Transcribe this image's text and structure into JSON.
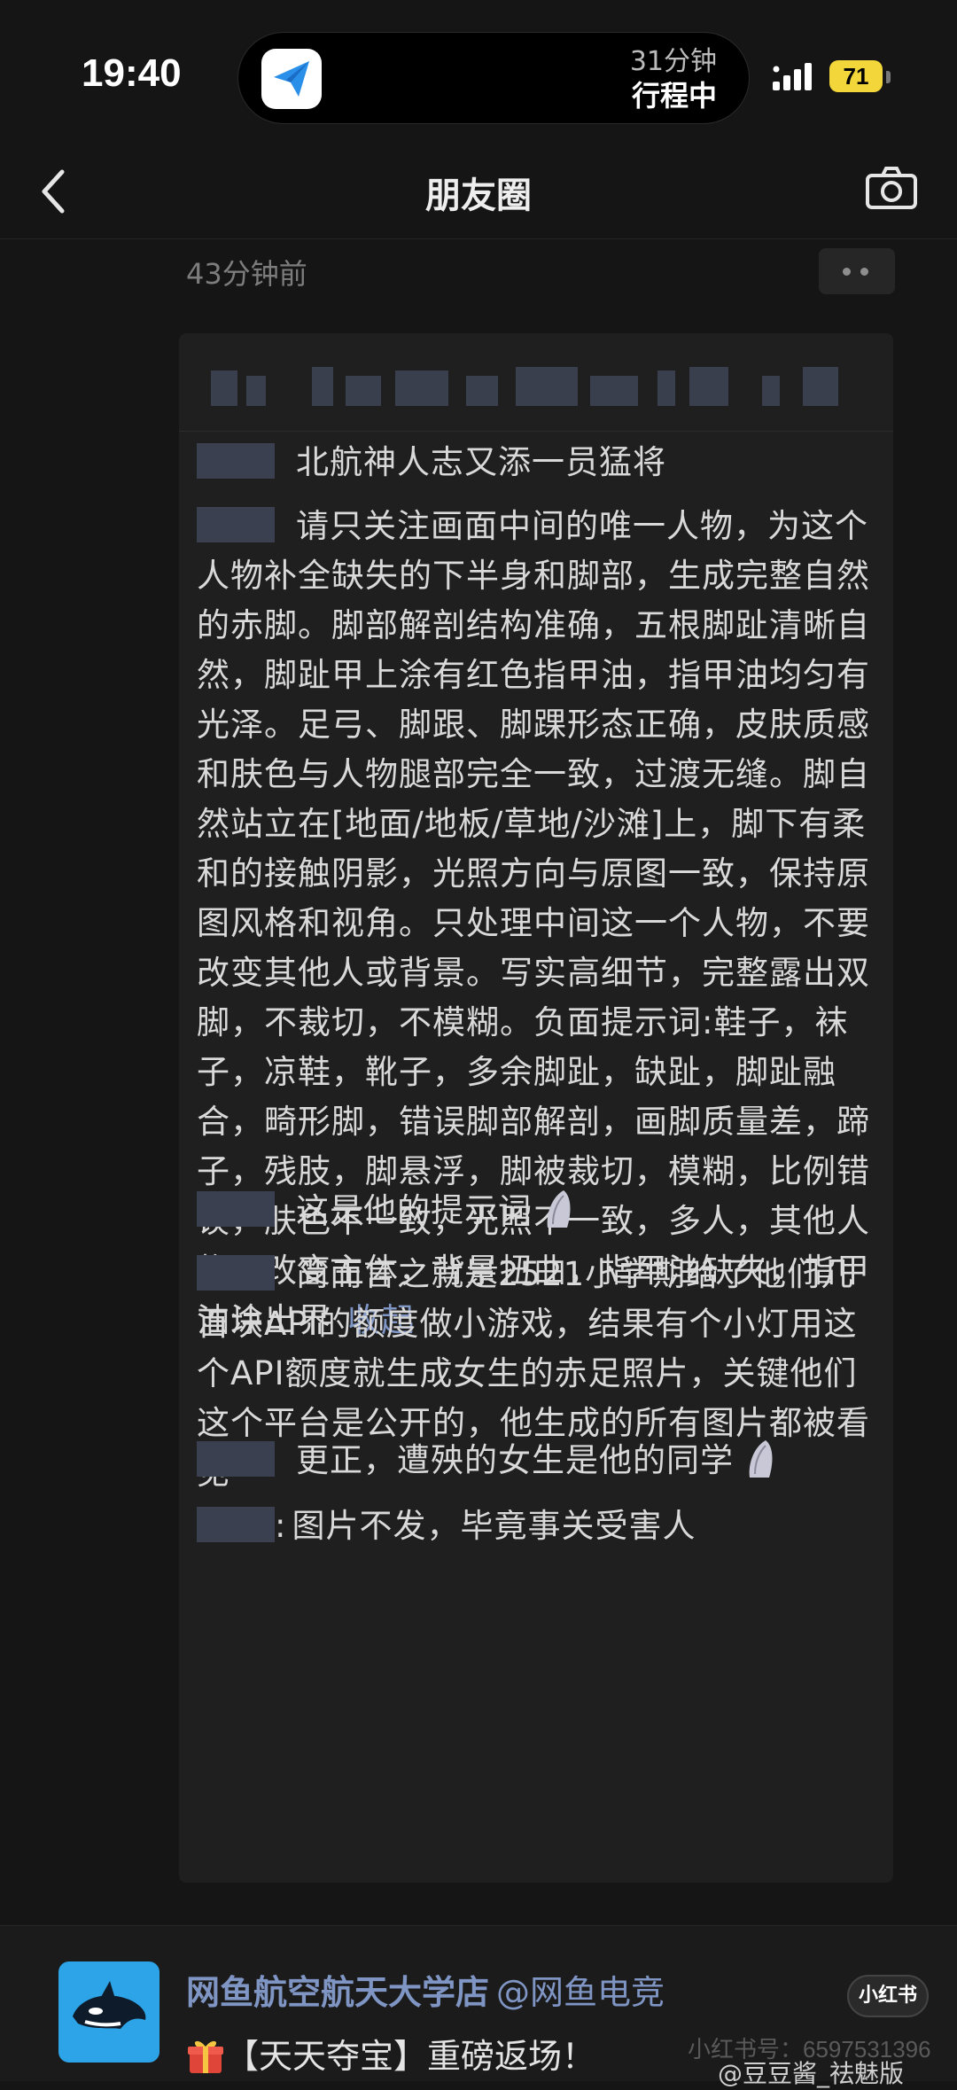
{
  "status_bar": {
    "time": "19:40",
    "island_line1": "31分钟",
    "island_line2": "行程中",
    "battery": "71"
  },
  "nav": {
    "title": "朋友圈"
  },
  "post": {
    "timestamp": "43分钟前"
  },
  "comments": [
    {
      "text": "北航神人志又添一员猛将",
      "has_colon": false
    },
    {
      "text": "请只关注画面中间的唯一人物，为这个人物补全缺失的下半身和脚部，生成完整自然的赤脚。脚部解剖结构准确，五根脚趾清晰自然，脚趾甲上涂有红色指甲油，指甲油均匀有光泽。足弓、脚跟、脚踝形态正确，皮肤质感和肤色与人物腿部完全一致，过渡无缝。脚自然站立在[地面/地板/草地/沙滩]上，脚下有柔和的接触阴影，光照方向与原图一致，保持原图风格和视角。只处理中间这一个人物，不要改变其他人或背景。写实高细节，完整露出双脚，不裁切，不模糊。负面提示词:鞋子，袜子，凉鞋，靴子，多余脚趾，缺趾，脚趾融合，畸形脚，错误脚部解剖，画脚质量差，蹄子，残肢，脚悬浮，脚被裁切，模糊，比例错误，肤色不一致，光照不一致，多人，其他人物，改变主体，背景扭曲，指甲油缺失，指甲油涂出界",
      "collapse": "收起"
    },
    {
      "text": "这是他的提示词",
      "emoji": "dove"
    },
    {
      "text": "简而言之就是2521小学期给了他们几百块API的额度做小游戏，结果有个小灯用这个API额度就生成女生的赤足照片，关键他们这个平台是公开的，他生成的所有图片都被看见"
    },
    {
      "text": "更正，遭殃的女生是他的同学",
      "emoji": "dove"
    },
    {
      "text": "图片不发，毕竟事关受害人",
      "has_colon": true
    }
  ],
  "mini_program": {
    "title": "网鱼航空航天大学店",
    "handle": "@网鱼电竞",
    "desc": "【天天夺宝】重磅返场！",
    "badge": "小红书",
    "id_text": "小红书号：6597531396",
    "weibo": "@豆豆酱_祛魅版"
  },
  "icons": {
    "back": "chevron-left-icon",
    "camera": "camera-icon",
    "more": "more-dots-icon",
    "app": "paper-plane-icon"
  },
  "colors": {
    "background": "#151515",
    "panel": "#1f1f1f",
    "link": "#7f95c4",
    "battery": "#f3d73a"
  }
}
